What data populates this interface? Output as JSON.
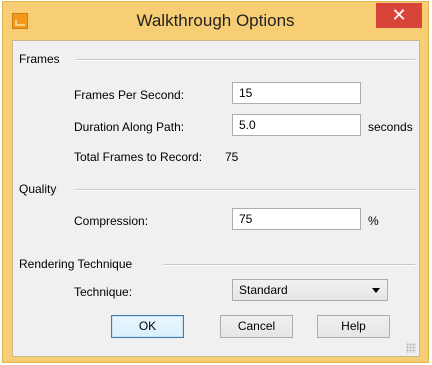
{
  "window": {
    "title": "Walkthrough Options",
    "app_icon": "walkthrough-app-icon",
    "close_glyph": "✕"
  },
  "frames": {
    "group_title": "Frames",
    "fps_label": "Frames Per Second:",
    "fps_value": "15",
    "duration_label": "Duration Along Path:",
    "duration_value": "5.0",
    "duration_unit": "seconds",
    "total_label": "Total Frames to Record:",
    "total_value": "75"
  },
  "quality": {
    "group_title": "Quality",
    "compression_label": "Compression:",
    "compression_value": "75",
    "compression_unit": "%"
  },
  "rendering": {
    "group_title": "Rendering Technique",
    "technique_label": "Technique:",
    "technique_value": "Standard"
  },
  "buttons": {
    "ok": "OK",
    "cancel": "Cancel",
    "help": "Help"
  },
  "colors": {
    "titlebar": "#f7ce73",
    "close_button": "#d9443a",
    "dialog_background": "#f0f0f0",
    "default_button_border": "#3c7fb1"
  }
}
